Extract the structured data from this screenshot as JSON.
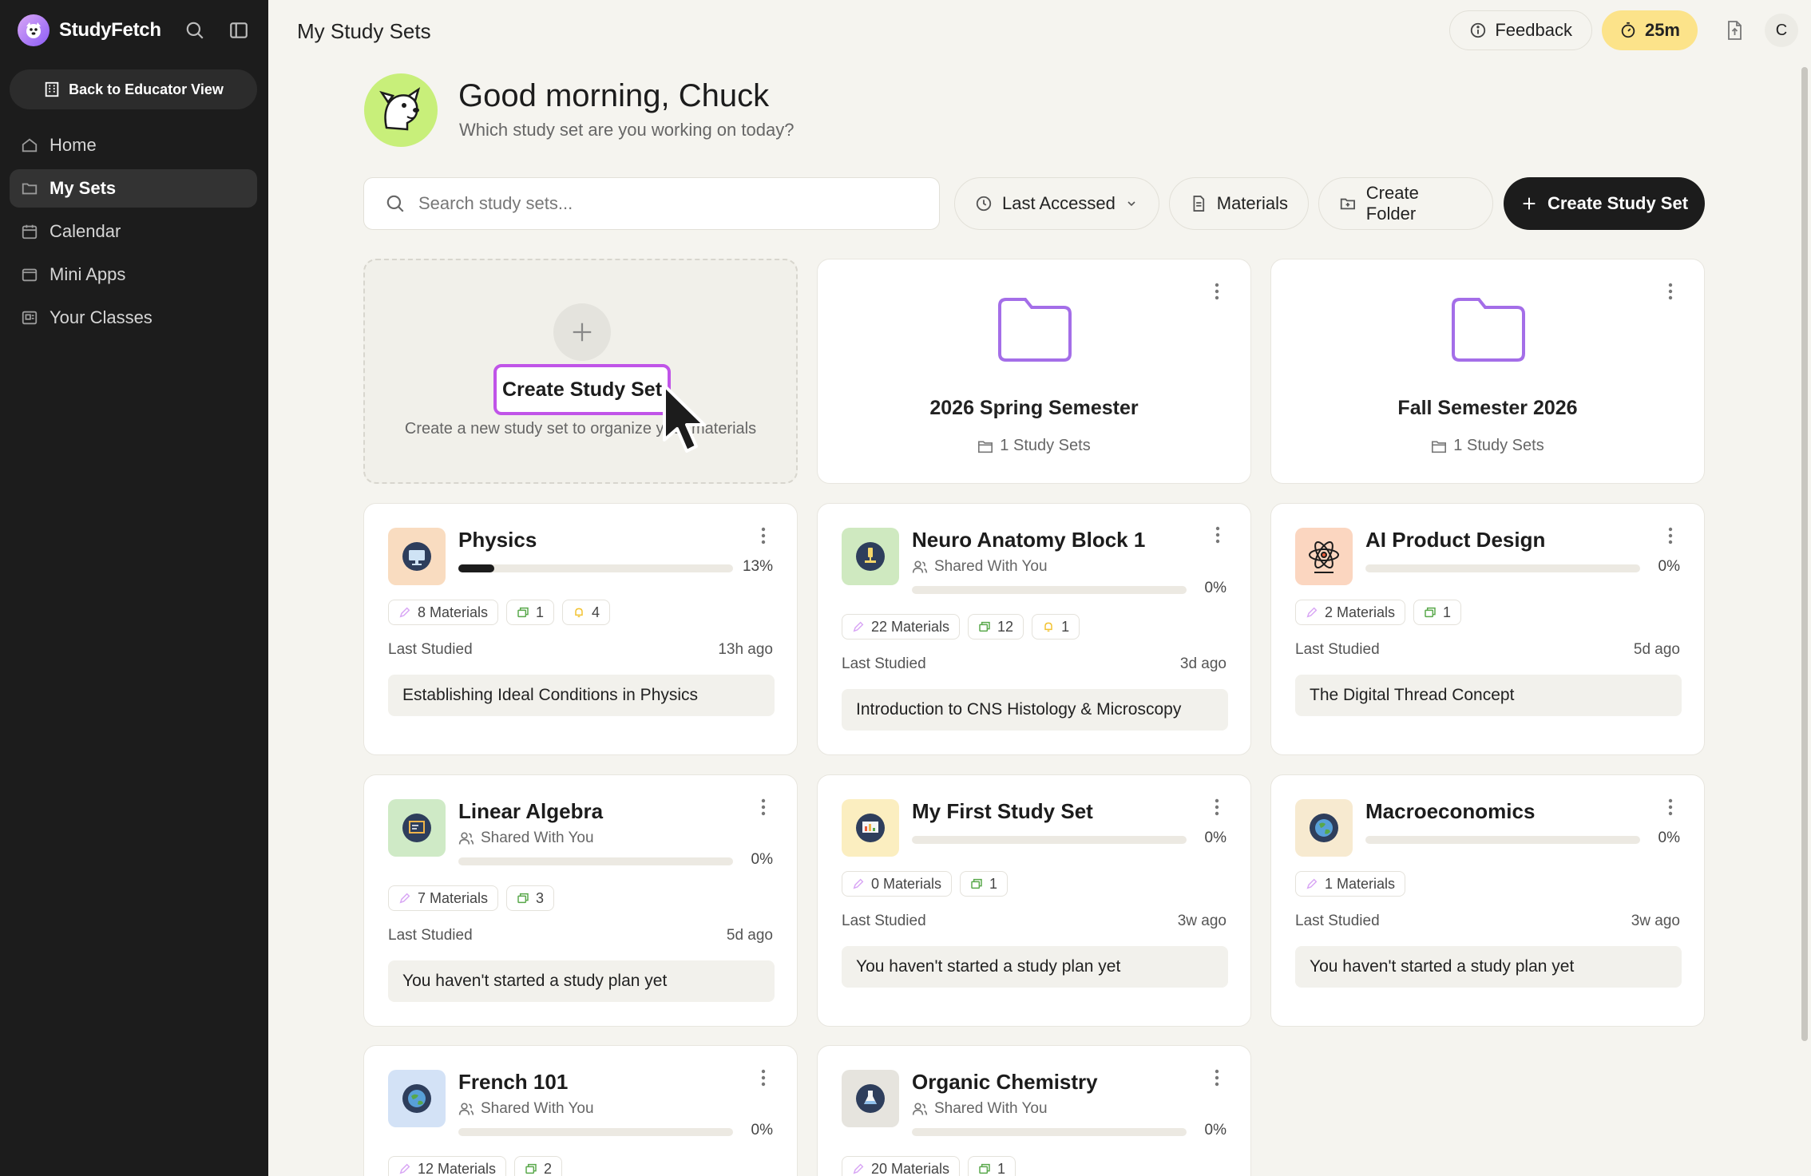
{
  "app": {
    "name": "StudyFetch"
  },
  "sidebar": {
    "educator_button": "Back to Educator View",
    "items": [
      {
        "label": "Home",
        "icon": "home-icon",
        "active": false
      },
      {
        "label": "My Sets",
        "icon": "folder-icon",
        "active": true
      },
      {
        "label": "Calendar",
        "icon": "calendar-icon",
        "active": false
      },
      {
        "label": "Mini Apps",
        "icon": "apps-icon",
        "active": false
      },
      {
        "label": "Your Classes",
        "icon": "classes-icon",
        "active": false
      }
    ]
  },
  "header": {
    "title": "My Study Sets",
    "feedback_label": "Feedback",
    "timer_label": "25m",
    "avatar_initial": "C"
  },
  "greeting": {
    "title": "Good morning, Chuck",
    "subtitle": "Which study set are you working on today?"
  },
  "toolbar": {
    "search_placeholder": "Search study sets...",
    "sort_label": "Last Accessed",
    "materials_label": "Materials",
    "create_folder_label": "Create Folder",
    "create_set_label": "Create Study Set"
  },
  "create_card": {
    "title": "Create Study Set",
    "subtitle": "Create a new study set to organize your materials"
  },
  "folders": [
    {
      "title": "2026 Spring Semester",
      "count_label": "1 Study Sets"
    },
    {
      "title": "Fall Semester 2026",
      "count_label": "1 Study Sets"
    }
  ],
  "sets": [
    {
      "title": "Physics",
      "shared": "",
      "progress": 0.13,
      "progress_label": "13%",
      "materials": "8 Materials",
      "flashcards": "1",
      "audio": "4",
      "last_studied_label": "Last Studied",
      "last_studied": "13h ago",
      "plan": "Establishing Ideal Conditions in Physics",
      "icon_bg": "#f9dcc0",
      "icon": "monitor-icon"
    },
    {
      "title": "Neuro Anatomy Block 1",
      "shared": "Shared With You",
      "progress": 0,
      "progress_label": "0%",
      "materials": "22 Materials",
      "flashcards": "12",
      "audio": "1",
      "last_studied_label": "Last Studied",
      "last_studied": "3d ago",
      "plan": "Introduction to CNS Histology & Microscopy",
      "icon_bg": "#cfe9c0",
      "icon": "microscope-icon"
    },
    {
      "title": "AI Product Design",
      "shared": "",
      "progress": 0,
      "progress_label": "0%",
      "materials": "2 Materials",
      "flashcards": "1",
      "audio": "",
      "last_studied_label": "Last Studied",
      "last_studied": "5d ago",
      "plan": "The Digital Thread Concept",
      "icon_bg": "#fbd6c0",
      "icon": "atom-icon"
    },
    {
      "title": "Linear Algebra",
      "shared": "Shared With You",
      "progress": 0,
      "progress_label": "0%",
      "materials": "7 Materials",
      "flashcards": "3",
      "audio": "",
      "last_studied_label": "Last Studied",
      "last_studied": "5d ago",
      "plan": "You haven't started a study plan yet",
      "icon_bg": "#cfeac6",
      "icon": "chalkboard-icon"
    },
    {
      "title": "My First Study Set",
      "shared": "",
      "progress": 0,
      "progress_label": "0%",
      "materials": "0 Materials",
      "flashcards": "1",
      "audio": "",
      "last_studied_label": "Last Studied",
      "last_studied": "3w ago",
      "plan": "You haven't started a study plan yet",
      "icon_bg": "#fbeec0",
      "icon": "presentation-icon"
    },
    {
      "title": "Macroeconomics",
      "shared": "",
      "progress": 0,
      "progress_label": "0%",
      "materials": "1 Materials",
      "flashcards": "",
      "audio": "",
      "last_studied_label": "Last Studied",
      "last_studied": "3w ago",
      "plan": "You haven't started a study plan yet",
      "icon_bg": "#f7ead0",
      "icon": "globe-icon"
    },
    {
      "title": "French 101",
      "shared": "Shared With You",
      "progress": 0,
      "progress_label": "0%",
      "materials": "12 Materials",
      "flashcards": "2",
      "audio": "",
      "icon_bg": "#d3e2f6",
      "icon": "globe-icon"
    },
    {
      "title": "Organic Chemistry",
      "shared": "Shared With You",
      "progress": 0,
      "progress_label": "0%",
      "materials": "20 Materials",
      "flashcards": "1",
      "audio": "",
      "icon_bg": "#e6e4de",
      "icon": "flask-icon"
    }
  ]
}
